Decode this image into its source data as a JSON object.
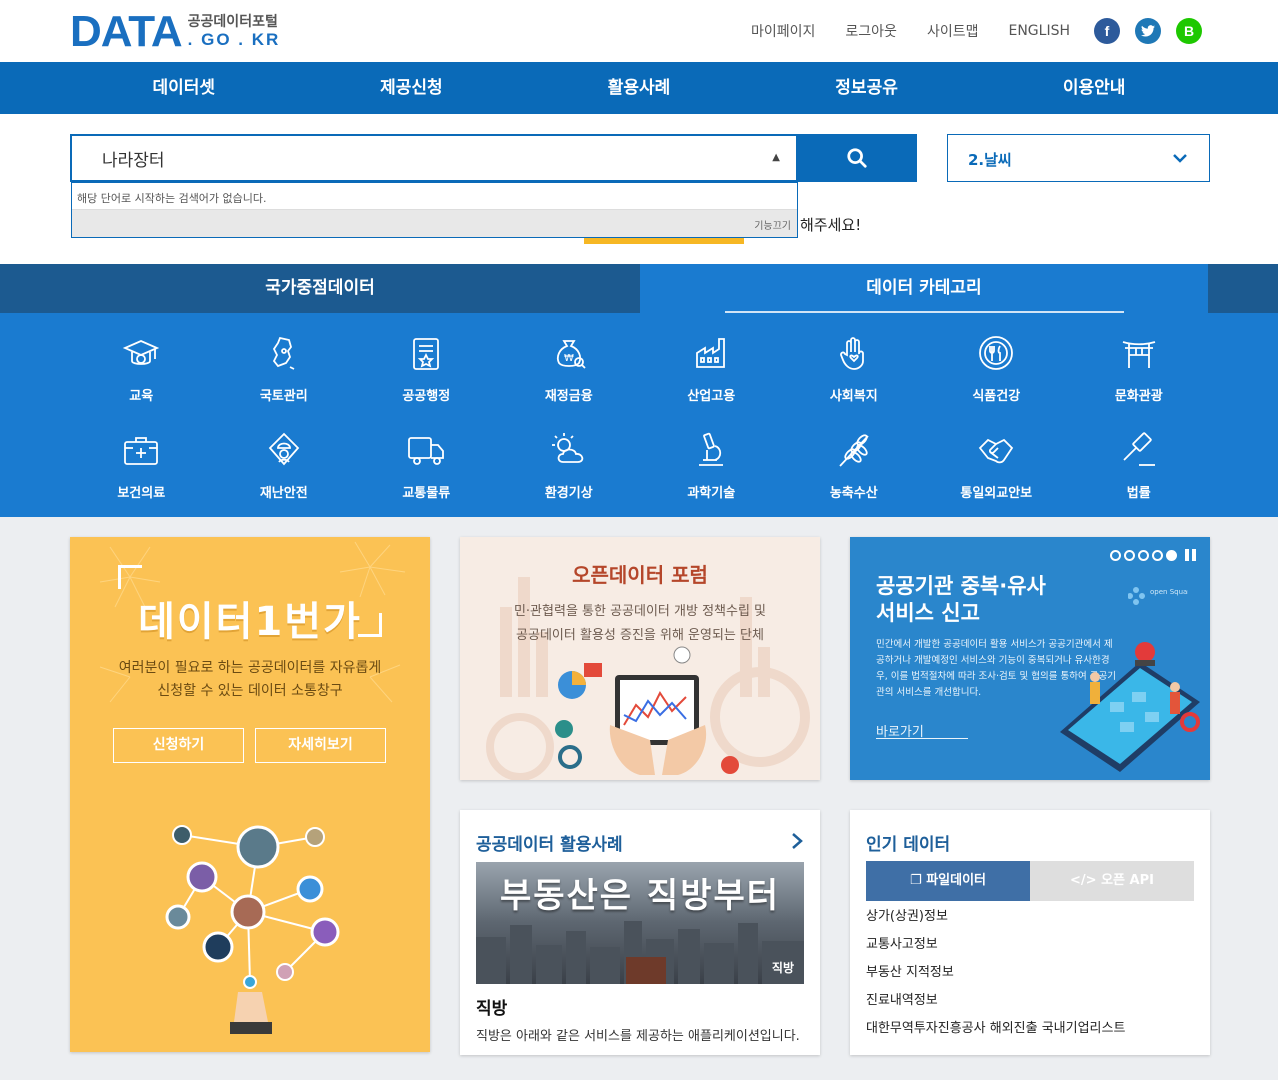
{
  "header": {
    "logo_main": "DATA",
    "logo_sub": "공공데이터포털",
    "logo_domain": ". GO . KR",
    "util_links": [
      "마이페이지",
      "로그아웃",
      "사이트맵",
      "ENGLISH"
    ],
    "sns": [
      {
        "name": "facebook-icon",
        "glyph": "f"
      },
      {
        "name": "twitter-icon",
        "glyph": "t"
      },
      {
        "name": "band-icon",
        "glyph": "B"
      }
    ]
  },
  "nav": [
    "데이터셋",
    "제공신청",
    "활용사례",
    "정보공유",
    "이용안내"
  ],
  "search": {
    "value": "나라장터",
    "autocomplete_message": "해당 단어로 시작하는 검색어가 없습니다.",
    "autocomplete_off": "기능끄기",
    "select_value": "2.날씨",
    "hint": "해주세요!"
  },
  "category_tabs": {
    "left": "국가중점데이터",
    "right": "데이터 카테고리"
  },
  "categories": [
    {
      "label": "교육",
      "icon": "graduation-cap-icon"
    },
    {
      "label": "국토관리",
      "icon": "korea-map-icon"
    },
    {
      "label": "공공행정",
      "icon": "document-icon"
    },
    {
      "label": "재정금융",
      "icon": "money-bag-icon"
    },
    {
      "label": "산업고용",
      "icon": "factory-icon"
    },
    {
      "label": "사회복지",
      "icon": "hand-heart-icon"
    },
    {
      "label": "식품건강",
      "icon": "dish-icon"
    },
    {
      "label": "문화관광",
      "icon": "gate-icon"
    },
    {
      "label": "보건의료",
      "icon": "medical-kit-icon"
    },
    {
      "label": "재난안전",
      "icon": "safety-icon"
    },
    {
      "label": "교통물류",
      "icon": "truck-icon"
    },
    {
      "label": "환경기상",
      "icon": "weather-icon"
    },
    {
      "label": "과학기술",
      "icon": "microscope-icon"
    },
    {
      "label": "농축수산",
      "icon": "wheat-icon"
    },
    {
      "label": "통일외교안보",
      "icon": "handshake-icon"
    },
    {
      "label": "법률",
      "icon": "gavel-icon"
    }
  ],
  "promo": {
    "title": "데이터1번가",
    "desc1": "여러분이 필요로 하는 공공데이터를 자유롭게",
    "desc2": "신청할 수 있는 데이터 소통창구",
    "apply": "신청하기",
    "more": "자세히보기"
  },
  "forum": {
    "title": "오픈데이터 포럼",
    "desc1": "민·관협력을 통한 공공데이터 개방 정책수립 및",
    "desc2": "공공데이터 활용성 증진을 위해 운영되는 단체"
  },
  "report": {
    "title1": "공공기관 중복·유사",
    "title2": "서비스 신고",
    "desc": "민간에서 개발한 공공데이터 활용 서비스가 공공기관에서 제공하거나 개발예정인 서비스와 기능이 중복되거나 유사한경우, 이를 법적절차에 따라 조사·검토 및 협의를 통하여 공공기관의 서비스를 개선합니다.",
    "link": "바로가기",
    "brand": "open Square"
  },
  "usecase": {
    "title": "공공데이터 활용사례",
    "banner": "부동산은 직방부터",
    "banner_brand": "직방",
    "name": "직방",
    "desc": "직방은 아래와 같은 서비스를 제공하는 애플리케이션입니다."
  },
  "popular": {
    "title": "인기 데이터",
    "tab_file": "파일데이터",
    "tab_api": "오픈 API",
    "items": [
      "상가(상권)정보",
      "교통사고정보",
      "부동산 지적정보",
      "진료내역정보",
      "대한무역투자진흥공사 해외진출 국내기업리스트"
    ]
  }
}
